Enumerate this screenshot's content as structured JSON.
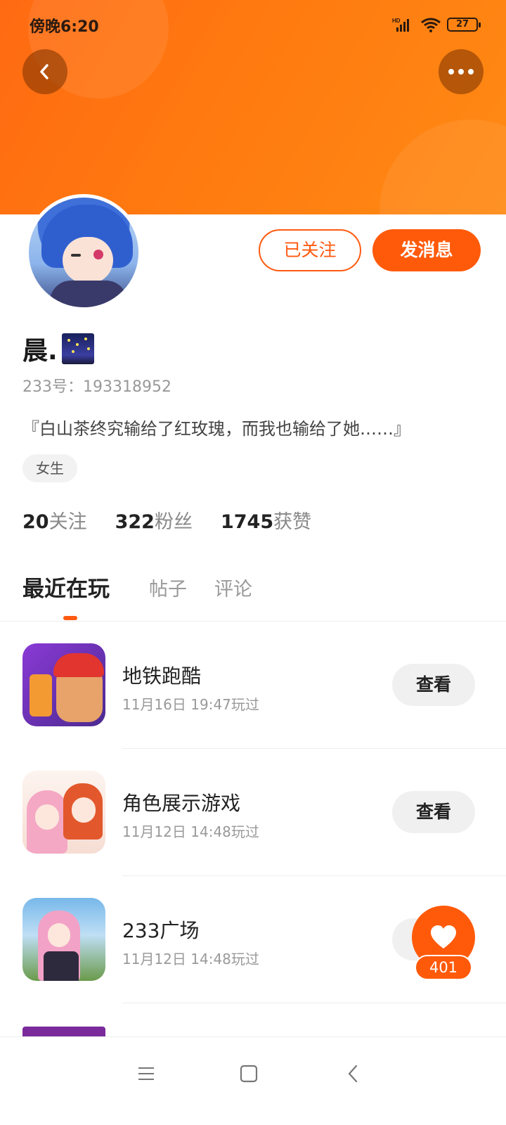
{
  "status_bar": {
    "time": "傍晚6:20",
    "network": "HD",
    "battery": "27"
  },
  "header": {
    "back_icon": "chevron-left-icon",
    "more_icon": "more-horizontal-icon"
  },
  "profile": {
    "name": "晨.",
    "uid": "233号：193318952",
    "bio": "『白山茶终究输给了红玫瑰，而我也输给了她……』",
    "gender_tag": "女生",
    "follow_label": "已关注",
    "message_label": "发消息"
  },
  "stats": [
    {
      "value": "20",
      "label": "关注"
    },
    {
      "value": "322",
      "label": "粉丝"
    },
    {
      "value": "1745",
      "label": "获赞"
    }
  ],
  "tabs": [
    {
      "label": "最近在玩",
      "active": true
    },
    {
      "label": "帖子",
      "active": false
    },
    {
      "label": "评论",
      "active": false
    }
  ],
  "games": [
    {
      "title": "地铁跑酷",
      "played": "11月16日 19:47玩过",
      "action": "查看"
    },
    {
      "title": "角色展示游戏",
      "played": "11月12日 14:48玩过",
      "action": "查看"
    },
    {
      "title": "233广场",
      "played": "11月12日 14:48玩过",
      "action": "查看"
    }
  ],
  "like_fab": {
    "count": "401",
    "icon": "heart-icon"
  },
  "nav_bar": {
    "menu_icon": "menu-icon",
    "home_icon": "square-home-icon",
    "back_icon": "back-arrow-icon"
  },
  "colors": {
    "accent": "#ff5a0a",
    "banner": "#ff7a10"
  }
}
